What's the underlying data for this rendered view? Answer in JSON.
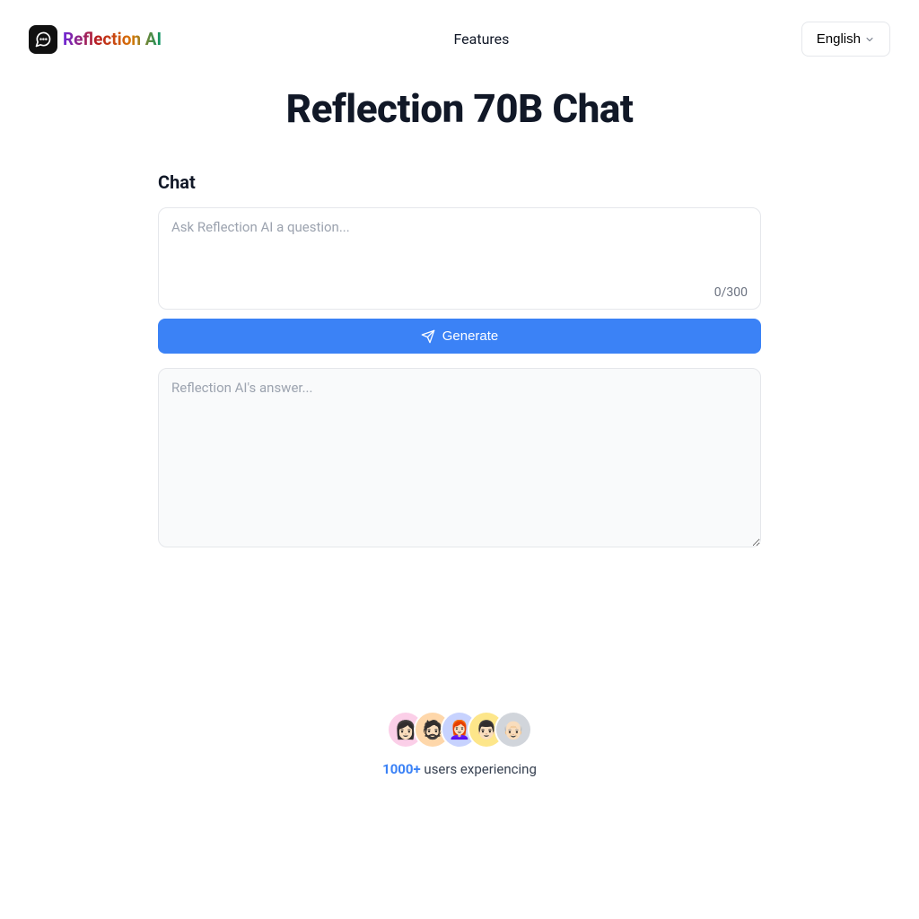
{
  "header": {
    "brand_name": "Reflection AI",
    "nav_features": "Features",
    "language_label": "English"
  },
  "main": {
    "page_title": "Reflection 70B Chat",
    "section_title": "Chat",
    "question_placeholder": "Ask Reflection AI a question...",
    "char_counter": "0/300",
    "generate_label": "Generate",
    "answer_placeholder": "Reflection AI's answer..."
  },
  "social": {
    "count_label": "1000+",
    "users_text": " users experiencing",
    "avatars": [
      {
        "bg": "#fbcfe8",
        "emoji": "👩🏻"
      },
      {
        "bg": "#fed7aa",
        "emoji": "🧔🏻"
      },
      {
        "bg": "#c7d2fe",
        "emoji": "👩🏻‍🦰"
      },
      {
        "bg": "#fde68a",
        "emoji": "👨🏻"
      },
      {
        "bg": "#d1d5db",
        "emoji": "👴🏻"
      }
    ]
  }
}
